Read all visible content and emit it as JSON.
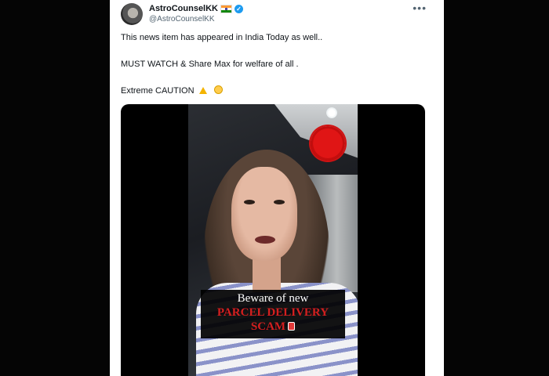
{
  "tweet": {
    "author": {
      "display_name": "AstroCounselKK",
      "handle": "@AstroCounselKK",
      "verified": true
    },
    "more_label": "•••",
    "lines": [
      "This news item has appeared in India Today as well..",
      "MUST WATCH & Share Max for welfare of all .",
      "Extreme CAUTION"
    ]
  },
  "video": {
    "caption": {
      "line1": "Beware of new",
      "line2": "PARCEL DELIVERY",
      "line3": "SCAM"
    }
  },
  "colors": {
    "background": "#000000",
    "card": "#ffffff",
    "verified_badge": "#1d9bf0",
    "caption_red": "#d41f1f",
    "seal_red": "#e01515"
  },
  "icons": [
    "india-flag-icon",
    "verified-badge-icon",
    "warning-emoji-icon",
    "flushed-face-emoji-icon",
    "parcel-emoji-icon"
  ]
}
